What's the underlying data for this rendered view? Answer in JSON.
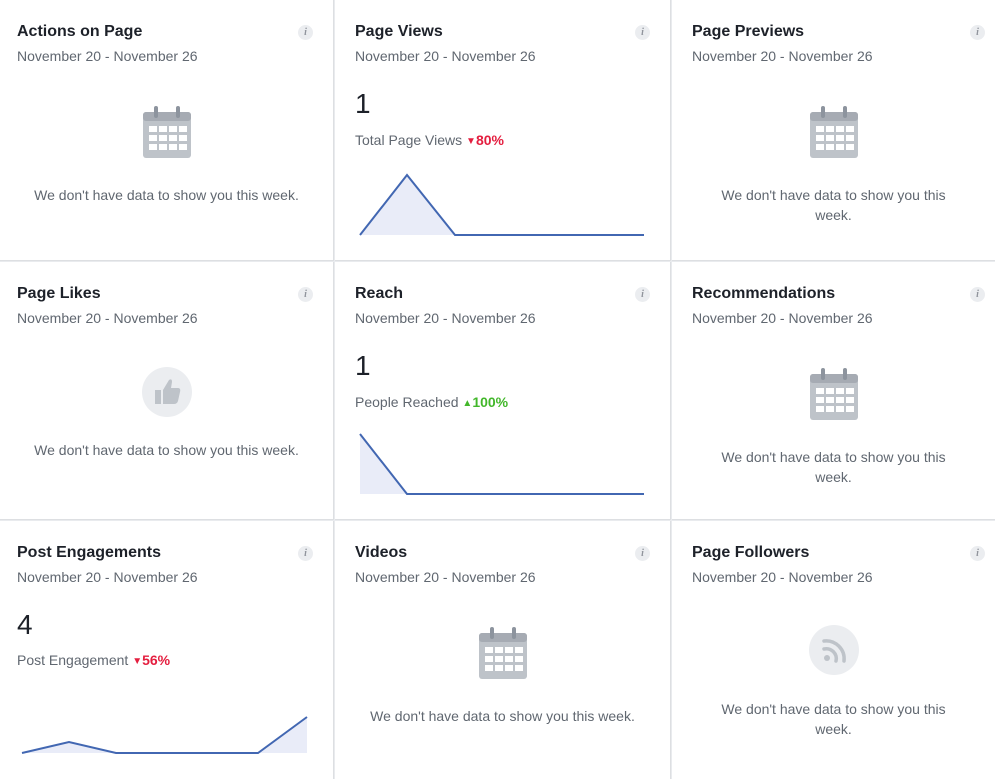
{
  "date_range": "November 20 - November 26",
  "info_glyph": "i",
  "empty_message": "We don't have data to show you this week.",
  "colors": {
    "line": "#4267b2",
    "fill": "#e9ecf8",
    "down": "#e41e3f",
    "up": "#42b72a",
    "icon": "#bec3c9"
  },
  "cards": {
    "actions_on_page": {
      "title": "Actions on Page",
      "icon": "calendar-icon"
    },
    "page_views": {
      "title": "Page Views",
      "value": "1",
      "metric_label": "Total Page Views",
      "change_arrow": "▼",
      "change": "80%",
      "direction": "down"
    },
    "page_previews": {
      "title": "Page Previews",
      "icon": "calendar-icon"
    },
    "page_likes": {
      "title": "Page Likes",
      "icon": "thumbs-up-icon"
    },
    "reach": {
      "title": "Reach",
      "value": "1",
      "metric_label": "People Reached",
      "change_arrow": "▲",
      "change": "100%",
      "direction": "up"
    },
    "recommendations": {
      "title": "Recommendations",
      "icon": "calendar-icon"
    },
    "post_engagements": {
      "title": "Post Engagements",
      "value": "4",
      "metric_label": "Post Engagement",
      "change_arrow": "▼",
      "change": "56%",
      "direction": "down"
    },
    "videos": {
      "title": "Videos",
      "icon": "calendar-icon"
    },
    "page_followers": {
      "title": "Page Followers",
      "icon": "rss-icon"
    }
  }
}
